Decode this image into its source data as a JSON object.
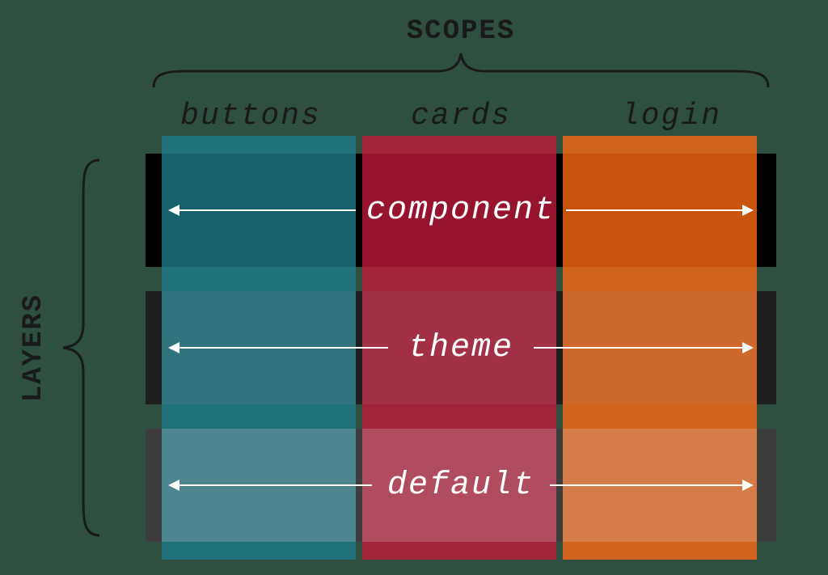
{
  "axes": {
    "scopes_label": "SCOPES",
    "layers_label": "LAYERS"
  },
  "scopes": [
    {
      "name": "buttons",
      "color": "#1c7c8c"
    },
    {
      "name": "cards",
      "color": "#c01a3a"
    },
    {
      "name": "login",
      "color": "#ff6a13"
    }
  ],
  "layers": [
    {
      "name": "component"
    },
    {
      "name": "theme"
    },
    {
      "name": "default"
    }
  ]
}
